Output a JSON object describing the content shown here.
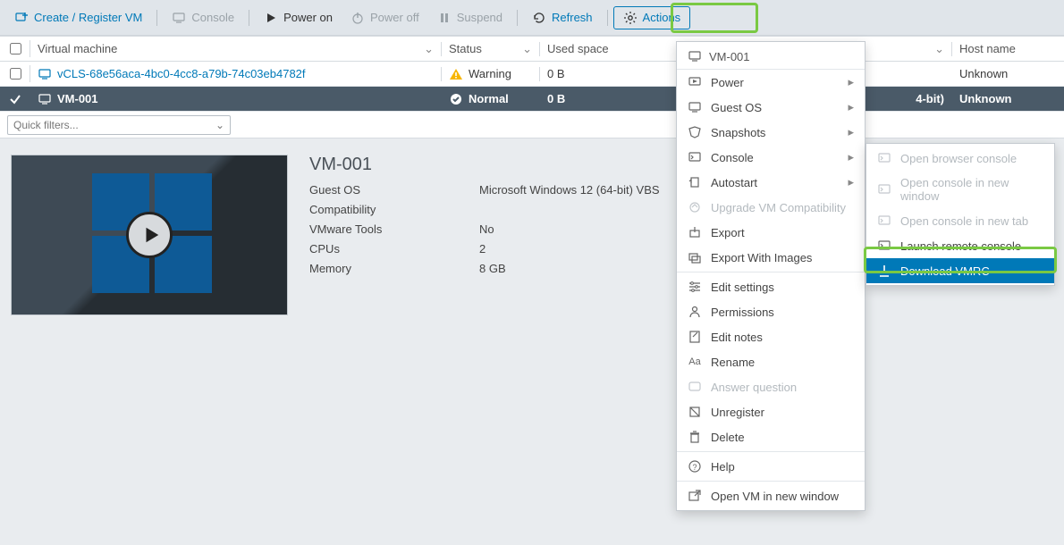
{
  "toolbar": {
    "create": "Create / Register VM",
    "console": "Console",
    "power_on": "Power on",
    "power_off": "Power off",
    "suspend": "Suspend",
    "refresh": "Refresh",
    "actions": "Actions"
  },
  "grid": {
    "headers": {
      "vm": "Virtual machine",
      "status": "Status",
      "used": "Used space",
      "host": "Host name"
    },
    "rows": [
      {
        "name": "vCLS-68e56aca-4bc0-4cc8-a79b-74c03eb4782f",
        "status": "Warning",
        "used": "0 B",
        "os": "",
        "host": "Unknown",
        "selected": false
      },
      {
        "name": "VM-001",
        "status": "Normal",
        "used": "0 B",
        "os": "4-bit)",
        "host": "Unknown",
        "selected": true
      }
    ]
  },
  "filters": {
    "placeholder": "Quick filters..."
  },
  "details": {
    "title": "VM-001",
    "props": [
      {
        "k": "Guest OS",
        "v": "Microsoft Windows 12 (64-bit) VBS"
      },
      {
        "k": "Compatibility",
        "v": ""
      },
      {
        "k": "VMware Tools",
        "v": "No"
      },
      {
        "k": "CPUs",
        "v": "2"
      },
      {
        "k": "Memory",
        "v": "8 GB"
      }
    ]
  },
  "menu": {
    "title": "VM-001",
    "items": [
      {
        "label": "Power",
        "sub": true,
        "icon": "power"
      },
      {
        "label": "Guest OS",
        "sub": true,
        "icon": "monitor"
      },
      {
        "label": "Snapshots",
        "sub": true,
        "icon": "tag"
      },
      {
        "label": "Console",
        "sub": true,
        "icon": "console"
      },
      {
        "label": "Autostart",
        "sub": true,
        "icon": "autostart"
      },
      {
        "label": "Upgrade VM Compatibility",
        "disabled": true,
        "icon": "upgrade"
      },
      {
        "label": "Export",
        "icon": "export"
      },
      {
        "label": "Export With Images",
        "icon": "export-img"
      },
      {
        "sep": true
      },
      {
        "label": "Edit settings",
        "icon": "settings"
      },
      {
        "label": "Permissions",
        "icon": "permissions"
      },
      {
        "label": "Edit notes",
        "icon": "notes"
      },
      {
        "label": "Rename",
        "icon": "rename"
      },
      {
        "label": "Answer question",
        "disabled": true,
        "icon": "question"
      },
      {
        "label": "Unregister",
        "icon": "unregister"
      },
      {
        "label": "Delete",
        "icon": "delete"
      },
      {
        "sep": true
      },
      {
        "label": "Help",
        "icon": "help"
      },
      {
        "sep": true
      },
      {
        "label": "Open VM in new window",
        "icon": "open-window"
      }
    ]
  },
  "submenu": {
    "items": [
      {
        "label": "Open browser console",
        "disabled": true,
        "icon": "console"
      },
      {
        "label": "Open console in new window",
        "disabled": true,
        "icon": "console"
      },
      {
        "label": "Open console in new tab",
        "disabled": true,
        "icon": "console"
      },
      {
        "label": "Launch remote console",
        "icon": "console"
      },
      {
        "label": "Download VMRC",
        "selected": true,
        "icon": "download"
      }
    ]
  }
}
